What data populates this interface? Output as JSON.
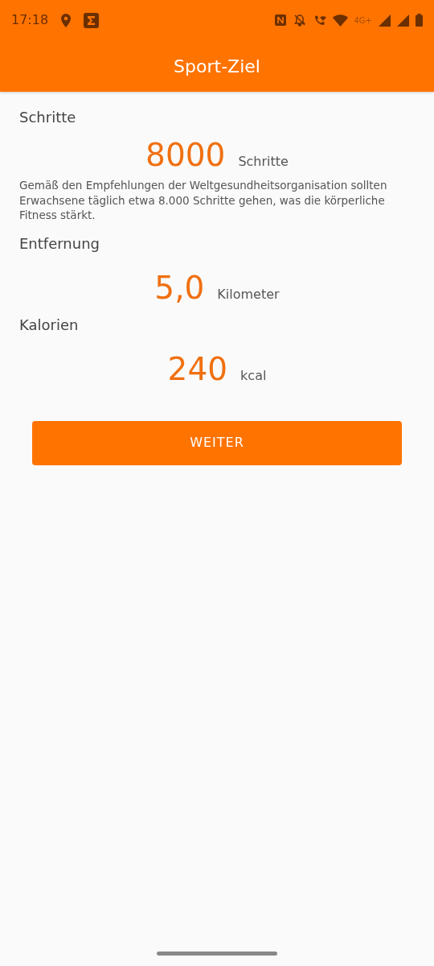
{
  "status_bar": {
    "time": "17:18",
    "network": "4G+"
  },
  "app_bar": {
    "title": "Sport-Ziel"
  },
  "goals": [
    {
      "label": "Schritte",
      "value": "8000",
      "unit": "Schritte",
      "description": "Gemäß den Empfehlungen der Weltgesundheitsorganisation sollten Erwachsene täglich etwa 8.000 Schritte gehen, was die körperliche Fitness stärkt."
    },
    {
      "label": "Entfernung",
      "value": "5,0",
      "unit": "Kilometer"
    },
    {
      "label": "Kalorien",
      "value": "240",
      "unit": "kcal"
    }
  ],
  "button": "WEITER"
}
